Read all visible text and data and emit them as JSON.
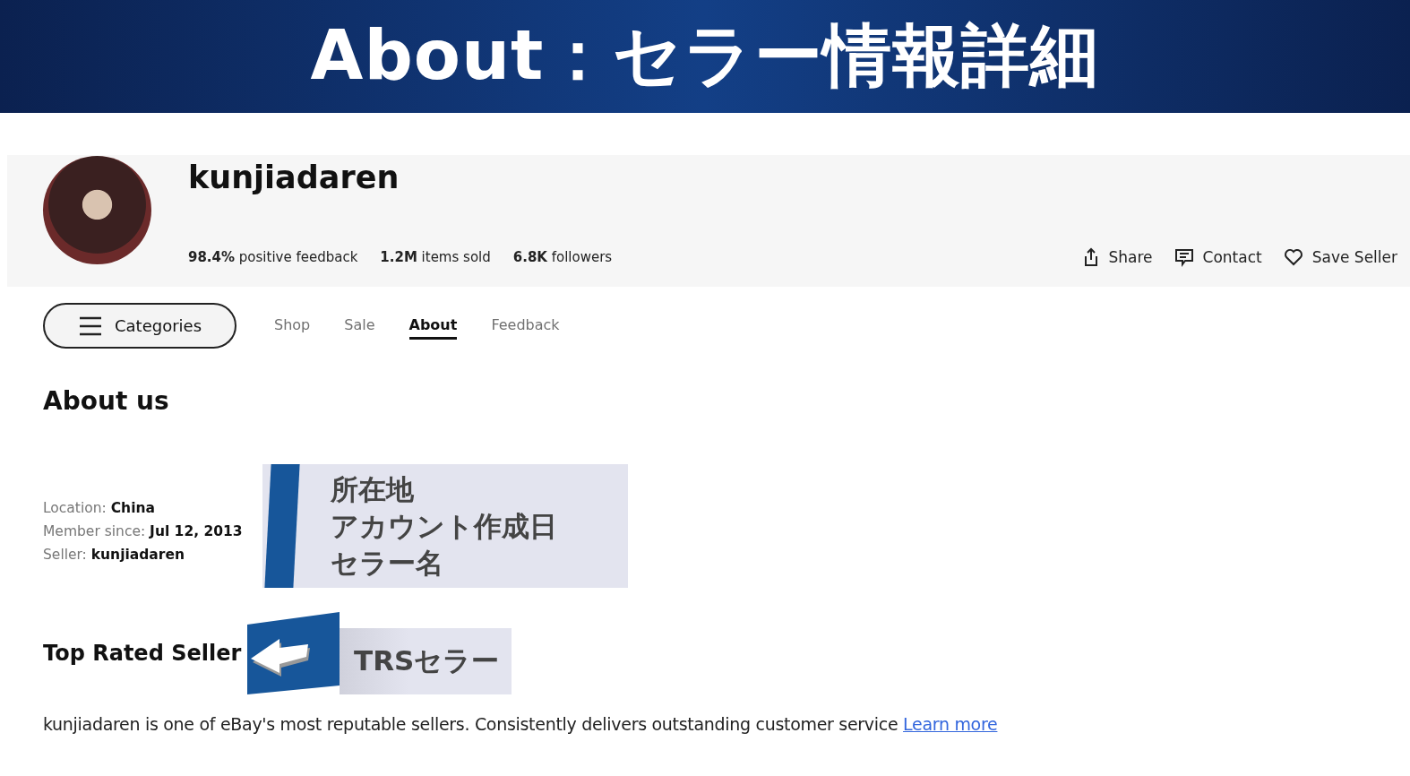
{
  "banner": {
    "title": "About：セラー情報詳細"
  },
  "seller": {
    "name": "kunjiadaren",
    "stats": [
      "**98.4%** positive feedback",
      "**1.2M** items sold",
      "**6.8K** followers"
    ],
    "actions": [
      {
        "kind": "share",
        "label": "Share"
      },
      {
        "kind": "contact",
        "label": "Contact"
      },
      {
        "kind": "save",
        "label": "Save Seller"
      }
    ]
  },
  "nav": {
    "categories": "Categories",
    "tabs": [
      {
        "label": "Shop",
        "selected": false
      },
      {
        "label": "Sale",
        "selected": false
      },
      {
        "label": "About",
        "selected": true
      },
      {
        "label": "Feedback",
        "selected": false
      }
    ]
  },
  "about": {
    "heading": "About us",
    "details": [
      "Location: **China**",
      "Member since: **Jul 12, 2013**",
      "Seller: **kunjiadaren**"
    ],
    "callout": [
      "所在地",
      "アカウント作成日",
      "セラー名"
    ],
    "top_rated": {
      "heading": "Top Rated Seller",
      "callout": "TRSセラー",
      "description": "kunjiadaren is one of eBay's most reputable sellers. Consistently delivers outstanding customer service",
      "link": "Learn more"
    }
  }
}
